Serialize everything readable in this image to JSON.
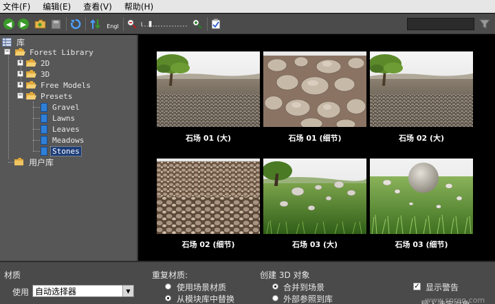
{
  "menu": [
    "文件(F)",
    "编辑(E)",
    "查看(V)",
    "帮助(H)"
  ],
  "toolbar": {
    "language_label": "Engl"
  },
  "tree": {
    "root": "库",
    "library": "Forest Library",
    "folders": [
      "2D",
      "3D",
      "Free Models",
      "Presets"
    ],
    "presets": [
      "Gravel",
      "Lawns",
      "Leaves",
      "Meadows",
      "Stones"
    ],
    "selected": "Stones",
    "user_library": "用户库"
  },
  "gallery": {
    "items": [
      {
        "caption": "石场 01 (大)"
      },
      {
        "caption": "石场 01 (细节)"
      },
      {
        "caption": "石场 02 (大)"
      },
      {
        "caption": "石场 02 (细节)"
      },
      {
        "caption": "石场 03 (大)"
      },
      {
        "caption": "石场 03 (细节)"
      }
    ]
  },
  "bottom": {
    "material": {
      "title": "材质",
      "use_label": "使用",
      "select_value": "自动选择器"
    },
    "duplicate": {
      "title": "重复材质:",
      "options": [
        "使用场景材质",
        "从模块库中替换"
      ],
      "selected_index": 1
    },
    "create3d": {
      "title": "创建 3D 对象",
      "options": [
        "合并到场景",
        "外部参照到库"
      ],
      "selected_index": 0
    },
    "show_warnings": {
      "label": "显示警告",
      "checked": true
    },
    "cutoff_option": "导入选定对象"
  },
  "watermark": "www.snren.com"
}
